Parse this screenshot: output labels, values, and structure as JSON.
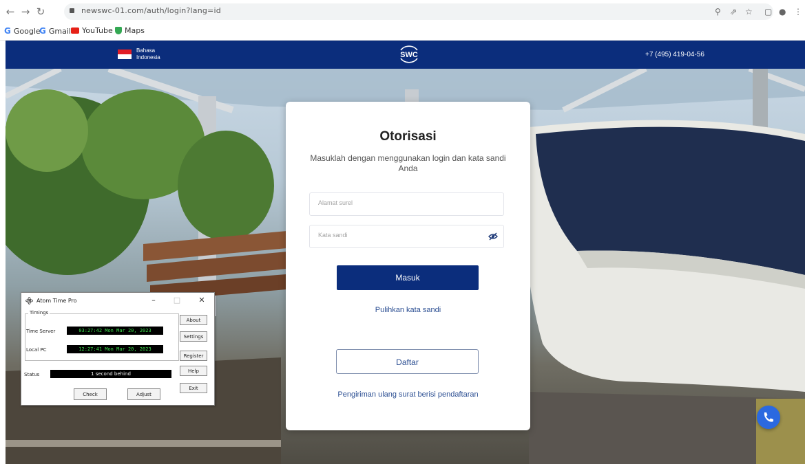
{
  "browser": {
    "url": "newswc-01.com/auth/login?lang=id",
    "bookmarks": [
      "Google",
      "Gmail",
      "YouTube",
      "Maps"
    ],
    "bookmark_icons": [
      "google-g-icon",
      "google-g-icon",
      "youtube-icon",
      "maps-icon"
    ]
  },
  "header": {
    "lang_line1": "Bahasa",
    "lang_line2": "Indonesia",
    "logo_text": "SWC",
    "phone": "+7 (495) 419-04-56",
    "bg_color": "#0b2d7c"
  },
  "login": {
    "title": "Otorisasi",
    "subtitle": "Masuklah dengan menggunakan login dan kata sandi Anda",
    "email_placeholder": "Alamat surel",
    "password_placeholder": "Kata sandi",
    "submit": "Masuk",
    "reset_link": "Pulihkan kata sandi",
    "register": "Daftar",
    "resend_link": "Pengiriman ulang surat berisi pendaftaran",
    "accent": "#0b2d7c"
  },
  "atomtime": {
    "title": "Atom Time Pro",
    "group_label": "Timings",
    "time_server_label": "Time Server",
    "time_server_value": "03:27:42   Mon Mar 20, 2023",
    "local_pc_label": "Local PC",
    "local_pc_value": "12:27:41   Mon Mar 20, 2023",
    "status_label": "Status",
    "status_value": "1 second behind",
    "buttons": {
      "about": "About",
      "settings": "Settings",
      "register": "Register",
      "help": "Help",
      "exit": "Exit",
      "check": "Check",
      "adjust": "Adjust"
    }
  }
}
